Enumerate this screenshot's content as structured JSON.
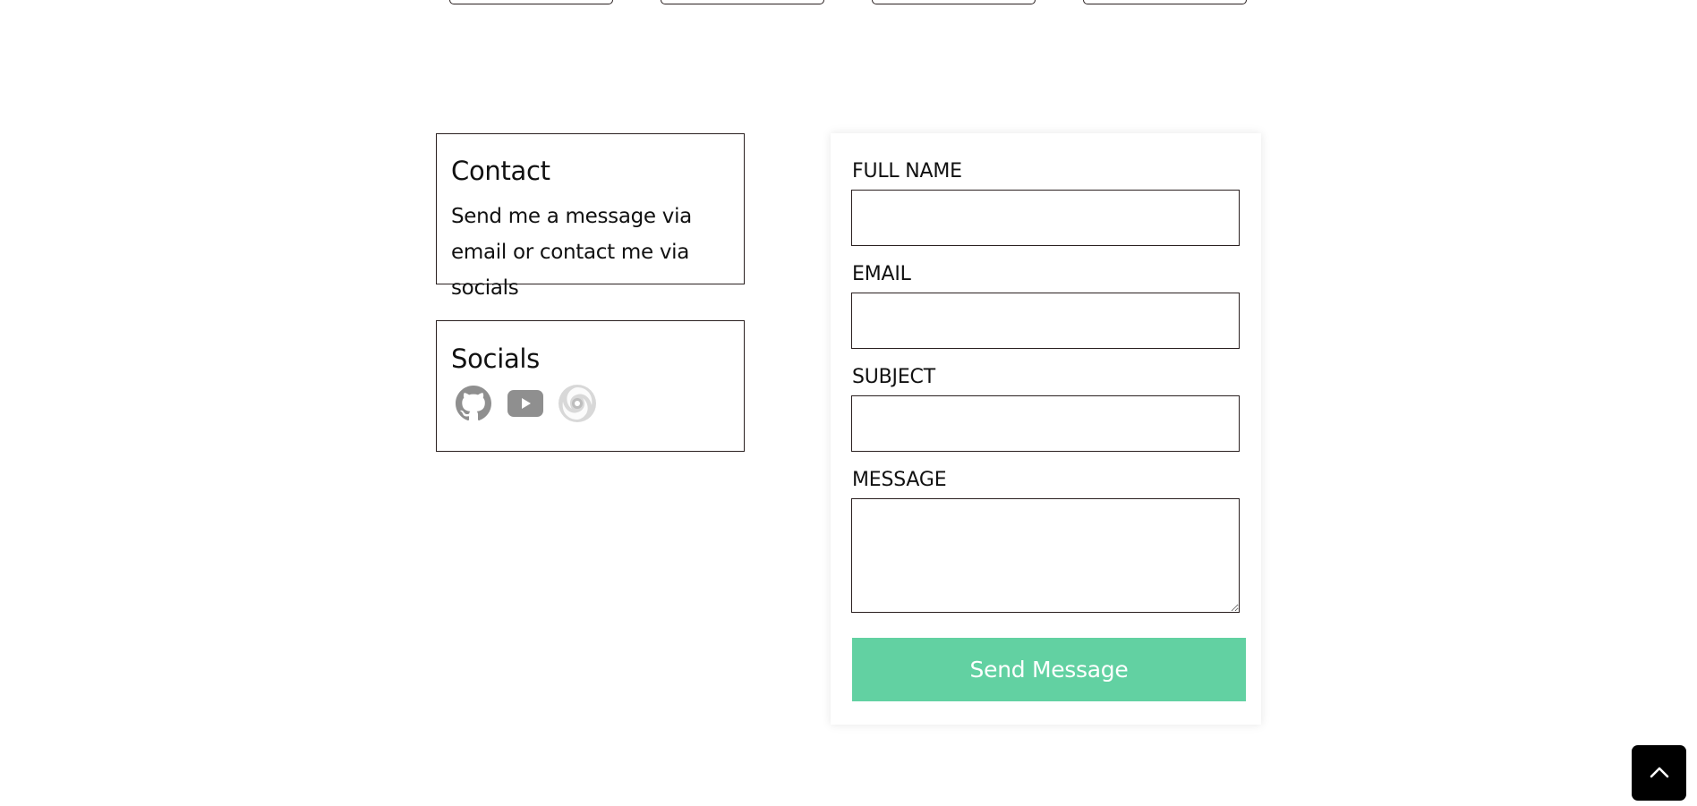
{
  "contact": {
    "title": "Contact",
    "text": "Send me a message via email or contact me via socials"
  },
  "socials": {
    "title": "Socials",
    "icons": [
      "github-icon",
      "youtube-icon",
      "portfolio-swirl-icon"
    ],
    "icon_color": "#8f8f8f"
  },
  "form": {
    "full_name_label": "FULL NAME",
    "full_name_value": "",
    "email_label": "EMAIL",
    "email_value": "",
    "subject_label": "SUBJECT",
    "subject_value": "",
    "message_label": "MESSAGE",
    "message_value": "",
    "submit_label": "Send Message",
    "submit_color": "#62d1a2"
  },
  "back_to_top": {
    "icon": "chevron-up-icon"
  }
}
